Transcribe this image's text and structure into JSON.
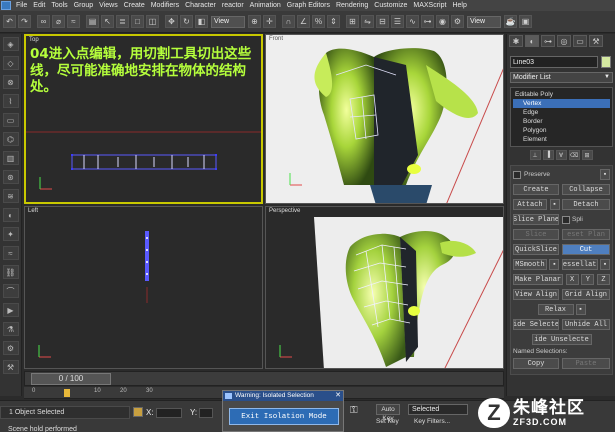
{
  "menubar": {
    "items": [
      "File",
      "Edit",
      "Tools",
      "Group",
      "Views",
      "Create",
      "Modifiers",
      "Character",
      "reactor",
      "Animation",
      "Graph Editors",
      "Rendering",
      "Customize",
      "MAXScript",
      "Help"
    ]
  },
  "toolbar": {
    "view_dropdown": "View",
    "view_dropdown2": "View"
  },
  "viewports": {
    "top_label": "Top",
    "front_label": "Front",
    "left_label": "Left",
    "persp_label": "Perspective",
    "annotation": "04进入点编辑，用切割工具切出这些线，尽可能准确地安排在物体的结构处。"
  },
  "command_panel": {
    "object_name": "Line03",
    "modifier_list": "Modifier List",
    "stack": [
      {
        "label": "Editable Poly",
        "level": "root",
        "selected": false
      },
      {
        "label": "Vertex",
        "level": "sub",
        "selected": true
      },
      {
        "label": "Edge",
        "level": "sub",
        "selected": false
      },
      {
        "label": "Border",
        "level": "sub",
        "selected": false
      },
      {
        "label": "Polygon",
        "level": "sub",
        "selected": false
      },
      {
        "label": "Element",
        "level": "sub",
        "selected": false
      }
    ],
    "buttons": {
      "preserve": "Preserve",
      "create": "Create",
      "collapse": "Collapse",
      "attach": "Attach",
      "detach": "Detach",
      "slice_plane": "Slice Plane",
      "split": "Spli",
      "slice": "Slice",
      "reset_plane": "eset Plan",
      "quickslice": "QuickSlice",
      "cut": "Cut",
      "msmooth": "MSmooth",
      "tessellate": "essellat",
      "make_planar": "Make Planar",
      "x": "X",
      "y": "Y",
      "z": "Z",
      "view_align": "View Align",
      "grid_align": "Grid Align",
      "relax": "Relax",
      "hide_selected": "ide Selecte",
      "unhide_all": "Unhide All",
      "hide_unselected": "ide Unselecte",
      "named_selections": "Named Selections:",
      "copy": "Copy",
      "paste": "Paste"
    }
  },
  "timeslider": {
    "frame_text": "0 / 100"
  },
  "timeline": {
    "ticks": [
      "0",
      "10",
      "20",
      "30"
    ]
  },
  "status": {
    "selection": "1 Object Selected",
    "prompt": "Scene hold performed",
    "x_label": "X:",
    "y_label": "Y:"
  },
  "isolation_dialog": {
    "title": "Warning: Isolated Selection",
    "exit_button": "Exit Isolation Mode"
  },
  "anim_controls": {
    "auto_key": "Auto Key",
    "selected": "Selected",
    "set_key": "Set Key",
    "key_filters": "Key Filters..."
  },
  "watermark": {
    "logo": "Z",
    "title": "朱峰社区",
    "url": "ZF3D.COM"
  },
  "colors": {
    "annotation_text": "#b5ff3c",
    "active_viewport_border": "#c8c800",
    "selection_blue": "#3b6fb8",
    "mesh_vertex": "#3c3cff"
  }
}
